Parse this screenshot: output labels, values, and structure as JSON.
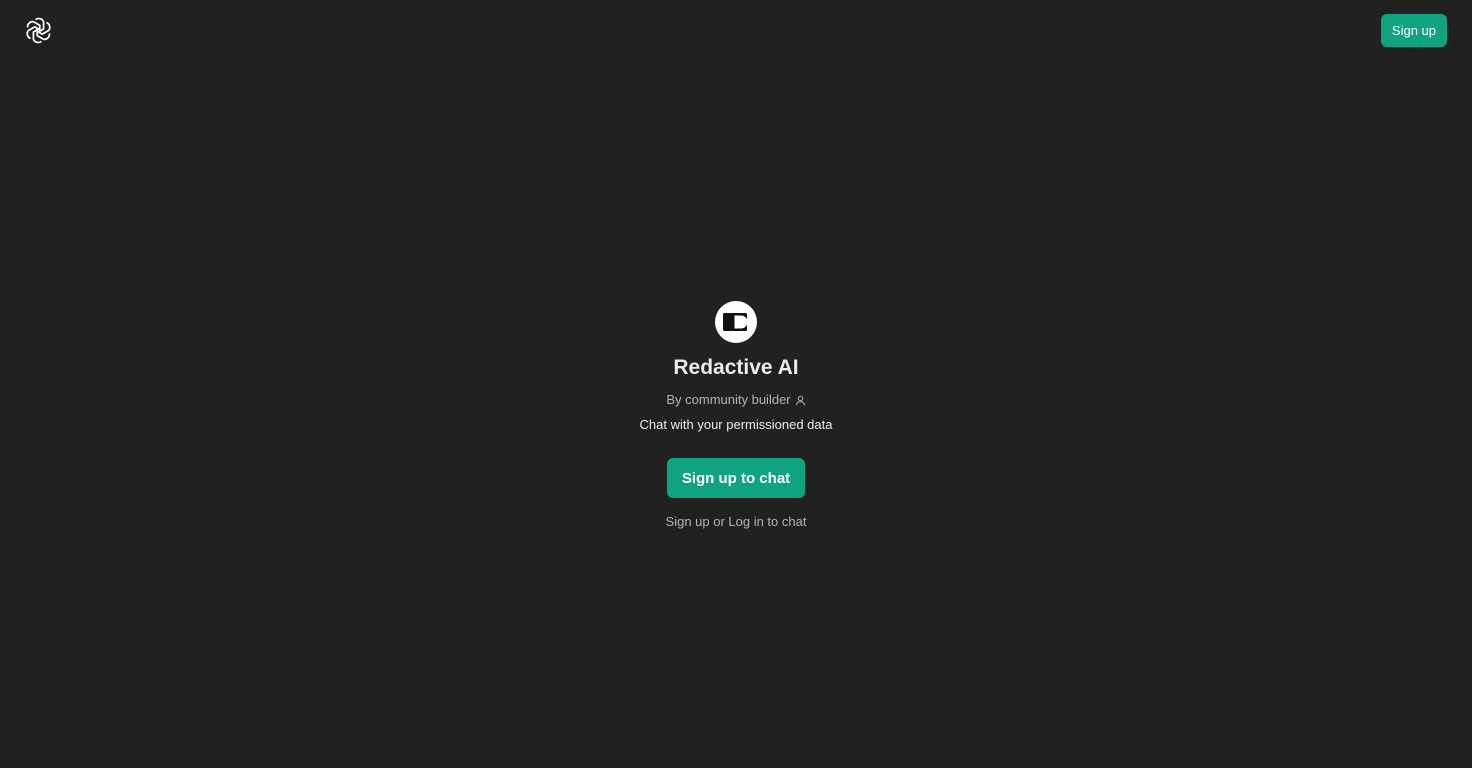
{
  "header": {
    "logo_icon": "openai-logo-icon",
    "signup_label": "Sign up"
  },
  "gpt": {
    "avatar_icon": "redactive-logo-icon",
    "title": "Redactive AI",
    "byline": "By community builder",
    "byline_icon": "person-icon",
    "description": "Chat with your permissioned data",
    "cta_label": "Sign up to chat",
    "footer_note": "Sign up or Log in to chat"
  },
  "colors": {
    "background": "#212121",
    "accent": "#10a37f",
    "text_primary": "#ececec",
    "text_secondary": "#b4b4b4"
  }
}
